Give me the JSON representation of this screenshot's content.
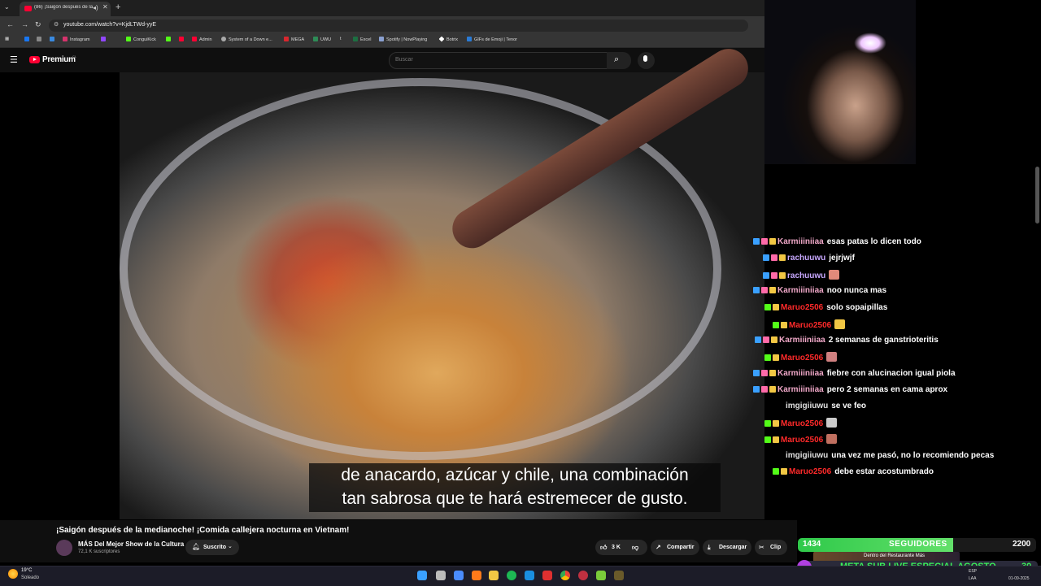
{
  "browser": {
    "tab_title": "(86) ¡Saigón después de la m",
    "url": "youtube.com/watch?v=KjdLTWd-yyE",
    "bookmarks": [
      "Instagram",
      "ConguiKick",
      "Admin",
      "System of a Down e...",
      "MEGA",
      "UWU",
      "Excel",
      "Spotify | NowPlaying",
      "Botrix",
      "GIFs de Emoji | Tenor"
    ]
  },
  "youtube": {
    "brand": "Premium",
    "region": "CL",
    "search_placeholder": "Buscar",
    "subtitle_line1": "de anacardo, azúcar y chile, una combinación",
    "subtitle_line2": "tan sabrosa que te hará estremecer de gusto.",
    "video_title": "¡Saigón después de la medianoche! ¡Comida callejera nocturna en Vietnam!",
    "channel_name": "MÁS Del Mejor Show de la Cultura",
    "channel_subs": "72,1 K suscriptores",
    "subscribe_label": "Suscrito",
    "likes": "3 K",
    "share_label": "Compartir",
    "download_label": "Descargar",
    "clip_label": "Clip"
  },
  "chat": [
    {
      "user": "Karmiiiniiaa",
      "color": "#f0a8c8",
      "msg": "esas patas lo dicen todo"
    },
    {
      "user": "rachuuwu",
      "color": "#c8a8ff",
      "msg": "jejrjwjf"
    },
    {
      "user": "rachuuwu",
      "color": "#c8a8ff",
      "msg": ""
    },
    {
      "user": "Karmiiiniiaa",
      "color": "#f0a8c8",
      "msg": "noo nunca mas"
    },
    {
      "user": "Maruo2506",
      "color": "#ff2a2a",
      "msg": "solo sopaipillas"
    },
    {
      "user": "Maruo2506",
      "color": "#ff2a2a",
      "msg": ""
    },
    {
      "user": "Karmiiiniiaa",
      "color": "#f0a8c8",
      "msg": "2 semanas de ganstrioteritis"
    },
    {
      "user": "Maruo2506",
      "color": "#ff2a2a",
      "msg": ""
    },
    {
      "user": "Karmiiiniiaa",
      "color": "#f0a8c8",
      "msg": "fiebre con alucinacion igual piola"
    },
    {
      "user": "Karmiiiniiaa",
      "color": "#f0a8c8",
      "msg": "pero 2 semanas en cama aprox"
    },
    {
      "user": "imgigiiuwu",
      "color": "#e0e0e0",
      "msg": "se ve feo"
    },
    {
      "user": "Maruo2506",
      "color": "#ff2a2a",
      "msg": ""
    },
    {
      "user": "Maruo2506",
      "color": "#ff2a2a",
      "msg": ""
    },
    {
      "user": "imgigiiuwu",
      "color": "#e0e0e0",
      "msg": "una vez me pasó, no lo recomiendo pecas"
    },
    {
      "user": "Maruo2506",
      "color": "#ff2a2a",
      "msg": "debe estar acostumbrado"
    }
  ],
  "followers_widget": {
    "current": "1434",
    "label": "SEGUIDORES",
    "goal": "2200",
    "progress": 0.652
  },
  "goal_widget": {
    "text": "META SUB LIVE ESPECIAL AGOSTO",
    "count": "30"
  },
  "ad_widget": {
    "line1": "Dentro del Restaurante Más"
  },
  "taskbar": {
    "temp": "19°C",
    "weather": "Soleado",
    "lang1": "ESP",
    "lang2": "LAA",
    "date": "01-09-2025"
  },
  "colors": {
    "accent": "#ff0033",
    "follow_green": "#2fc94a",
    "goal_text": "#3af05a"
  }
}
